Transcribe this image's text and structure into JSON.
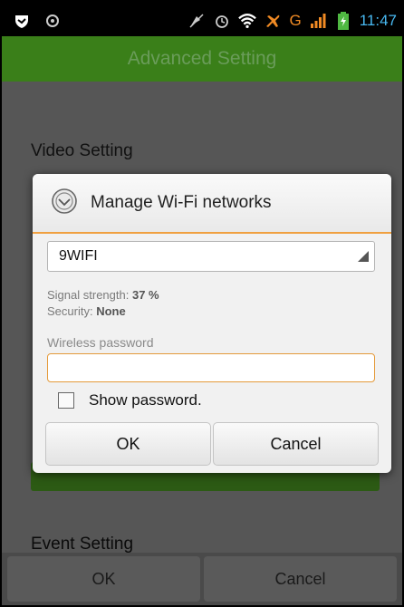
{
  "status_bar": {
    "time": "11:47",
    "network": "G",
    "icons": [
      "shield-icon",
      "notification-icon",
      "mute-icon",
      "alarm-icon",
      "wifi-icon",
      "airplane-icon",
      "signal-icon",
      "battery-icon"
    ],
    "colors": {
      "time": "#48b8f0",
      "network": "#f08a24",
      "battery": "#4fb842",
      "signal": "#f08a24"
    }
  },
  "header": {
    "title": "Advanced Setting",
    "color": "#3a7f19"
  },
  "background": {
    "sections": [
      "Video Setting",
      "Event Setting"
    ],
    "buttons": {
      "ok": "OK",
      "cancel": "Cancel"
    }
  },
  "dialog": {
    "title": "Manage Wi-Fi networks",
    "icon": "wifi-dialog-icon",
    "network": "9WIFI",
    "signal_label": "Signal strength:",
    "signal_value": "37 %",
    "security_label": "Security:",
    "security_value": "None",
    "password_label": "Wireless password",
    "password_value": "",
    "show_password_label": "Show password.",
    "show_password_checked": false,
    "ok_label": "OK",
    "cancel_label": "Cancel",
    "accent": "#f0a040"
  }
}
